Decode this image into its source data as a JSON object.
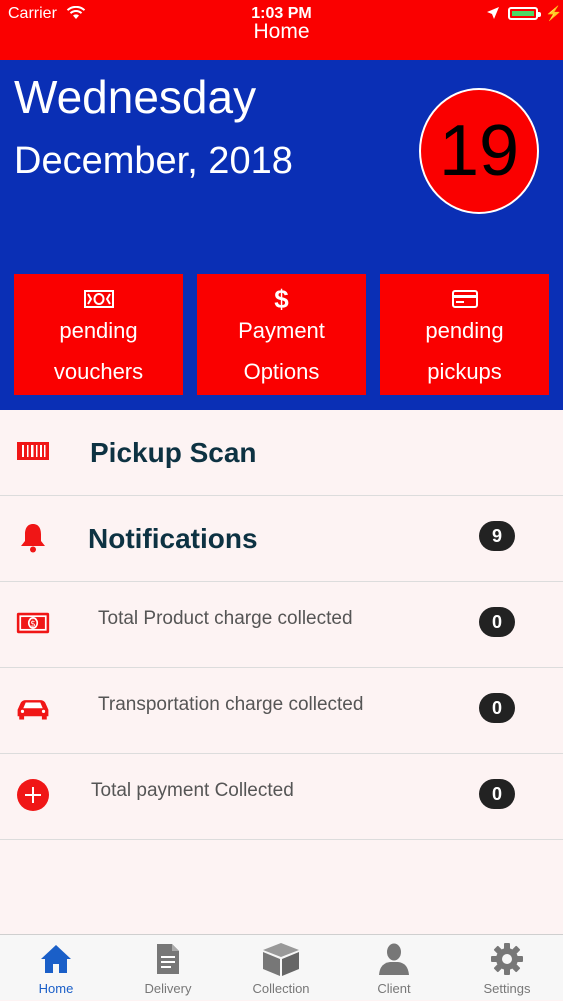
{
  "status_bar": {
    "carrier": "Carrier",
    "time": "1:03 PM"
  },
  "nav": {
    "title": "Home"
  },
  "header": {
    "day": "Wednesday",
    "month_year": "December, 2018",
    "date_number": "19"
  },
  "tiles": [
    {
      "line1": "pending",
      "line2": "vouchers",
      "icon": "money-icon"
    },
    {
      "line1": "Payment",
      "line2": "Options",
      "icon": "dollar-icon"
    },
    {
      "line1": "pending",
      "line2": "pickups",
      "icon": "card-icon"
    }
  ],
  "rows": [
    {
      "label": "Pickup Scan",
      "icon": "barcode-icon"
    },
    {
      "label": "Notifications",
      "icon": "bell-icon",
      "badge": "9"
    },
    {
      "label": "Total Product charge collected",
      "icon": "money-icon",
      "badge": "0"
    },
    {
      "label": "Transportation charge collected",
      "icon": "car-icon",
      "badge": "0"
    },
    {
      "label": "Total payment Collected",
      "icon": "plus-icon",
      "badge": "0"
    }
  ],
  "tabs": [
    {
      "label": "Home",
      "icon": "home-icon",
      "active": true
    },
    {
      "label": "Delivery",
      "icon": "document-icon"
    },
    {
      "label": "Collection",
      "icon": "box-icon"
    },
    {
      "label": "Client",
      "icon": "person-icon"
    },
    {
      "label": "Settings",
      "icon": "gear-icon"
    }
  ],
  "colors": {
    "status_bar": "#fa0000",
    "header_bg": "#0a2fb5",
    "tile_bg": "#fa0000",
    "list_bg": "#fdf3f3",
    "tab_active": "#1a5fc8"
  }
}
